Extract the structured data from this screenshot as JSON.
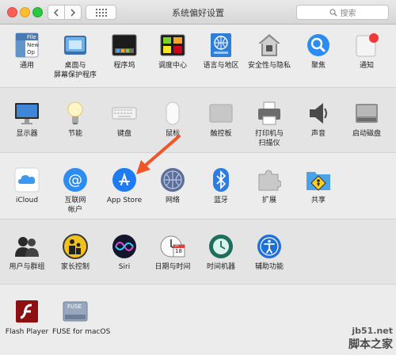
{
  "window": {
    "title": "系统偏好设置",
    "search_placeholder": "搜索"
  },
  "rows": [
    [
      {
        "name": "general",
        "label": "通用",
        "icon": "general-icon"
      },
      {
        "name": "desktop",
        "label": "桌面与\n屏幕保护程序",
        "icon": "desktop-screensaver-icon"
      },
      {
        "name": "dock",
        "label": "程序坞",
        "icon": "dock-icon"
      },
      {
        "name": "mission-control",
        "label": "调度中心",
        "icon": "mission-control-icon"
      },
      {
        "name": "language",
        "label": "语言与地区",
        "icon": "language-region-icon"
      },
      {
        "name": "security",
        "label": "安全性与隐私",
        "icon": "security-privacy-icon"
      },
      {
        "name": "spotlight",
        "label": "聚焦",
        "icon": "spotlight-icon"
      },
      {
        "name": "notifications",
        "label": "通知",
        "icon": "notifications-icon"
      }
    ],
    [
      {
        "name": "displays",
        "label": "显示器",
        "icon": "displays-icon"
      },
      {
        "name": "energy",
        "label": "节能",
        "icon": "energy-saver-icon"
      },
      {
        "name": "keyboard",
        "label": "键盘",
        "icon": "keyboard-icon"
      },
      {
        "name": "mouse",
        "label": "鼠标",
        "icon": "mouse-icon"
      },
      {
        "name": "trackpad",
        "label": "触控板",
        "icon": "trackpad-icon"
      },
      {
        "name": "printers",
        "label": "打印机与\n扫描仪",
        "icon": "printer-icon"
      },
      {
        "name": "sound",
        "label": "声音",
        "icon": "sound-icon"
      },
      {
        "name": "startup-disk",
        "label": "启动磁盘",
        "icon": "startup-disk-icon"
      }
    ],
    [
      {
        "name": "icloud",
        "label": "iCloud",
        "icon": "icloud-icon"
      },
      {
        "name": "internet-accounts",
        "label": "互联网\n帐户",
        "icon": "internet-accounts-icon"
      },
      {
        "name": "app-store",
        "label": "App Store",
        "icon": "app-store-icon"
      },
      {
        "name": "network",
        "label": "网络",
        "icon": "network-icon"
      },
      {
        "name": "bluetooth",
        "label": "蓝牙",
        "icon": "bluetooth-icon"
      },
      {
        "name": "extensions",
        "label": "扩展",
        "icon": "extensions-icon"
      },
      {
        "name": "sharing",
        "label": "共享",
        "icon": "sharing-icon"
      }
    ],
    [
      {
        "name": "users",
        "label": "用户与群组",
        "icon": "users-groups-icon"
      },
      {
        "name": "parental",
        "label": "家长控制",
        "icon": "parental-controls-icon"
      },
      {
        "name": "siri",
        "label": "Siri",
        "icon": "siri-icon"
      },
      {
        "name": "datetime",
        "label": "日期与时间",
        "icon": "date-time-icon"
      },
      {
        "name": "timemachine",
        "label": "时间机器",
        "icon": "time-machine-icon"
      },
      {
        "name": "accessibility",
        "label": "辅助功能",
        "icon": "accessibility-icon"
      }
    ],
    [
      {
        "name": "flash",
        "label": "Flash Player",
        "icon": "flash-player-icon"
      },
      {
        "name": "fuse",
        "label": "FUSE for macOS",
        "icon": "fuse-icon"
      }
    ]
  ],
  "icon_text": {
    "general_file": "File",
    "general_new": "New",
    "general_op": "Op",
    "calendar_day": "18",
    "calendar_month": "JUL",
    "fuse": "FUSE"
  },
  "watermark": {
    "line1": "jb51.net",
    "line2": "脚本之家"
  },
  "colors": {
    "accent": "#1e7bf1",
    "arrow": "#f0552a",
    "window_bg": "#ececec"
  }
}
